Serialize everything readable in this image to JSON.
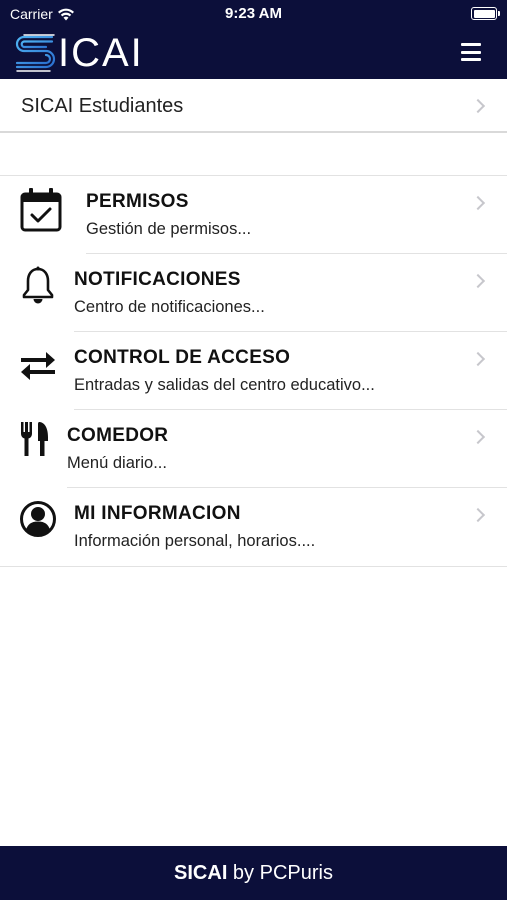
{
  "status_bar": {
    "carrier": "Carrier",
    "time": "9:23 AM"
  },
  "header": {
    "logo_text": "ICAI"
  },
  "section": {
    "title": "SICAI Estudiantes"
  },
  "menu": [
    {
      "title": "PERMISOS",
      "subtitle": "Gestión de permisos...",
      "icon": "calendar-check-icon"
    },
    {
      "title": "NOTIFICACIONES",
      "subtitle": "Centro de notificaciones...",
      "icon": "bell-icon"
    },
    {
      "title": "CONTROL DE ACCESO",
      "subtitle": "Entradas y salidas del centro educativo...",
      "icon": "swap-arrows-icon"
    },
    {
      "title": "COMEDOR",
      "subtitle": "Menú diario...",
      "icon": "fork-knife-icon"
    },
    {
      "title": "MI INFORMACION",
      "subtitle": "Información personal, horarios....",
      "icon": "user-circle-icon"
    }
  ],
  "footer": {
    "brand": "SICAI",
    "byline": " by PCPuris"
  },
  "colors": {
    "navy": "#0c0f3a",
    "logo_blue": "#3aa0e8"
  }
}
